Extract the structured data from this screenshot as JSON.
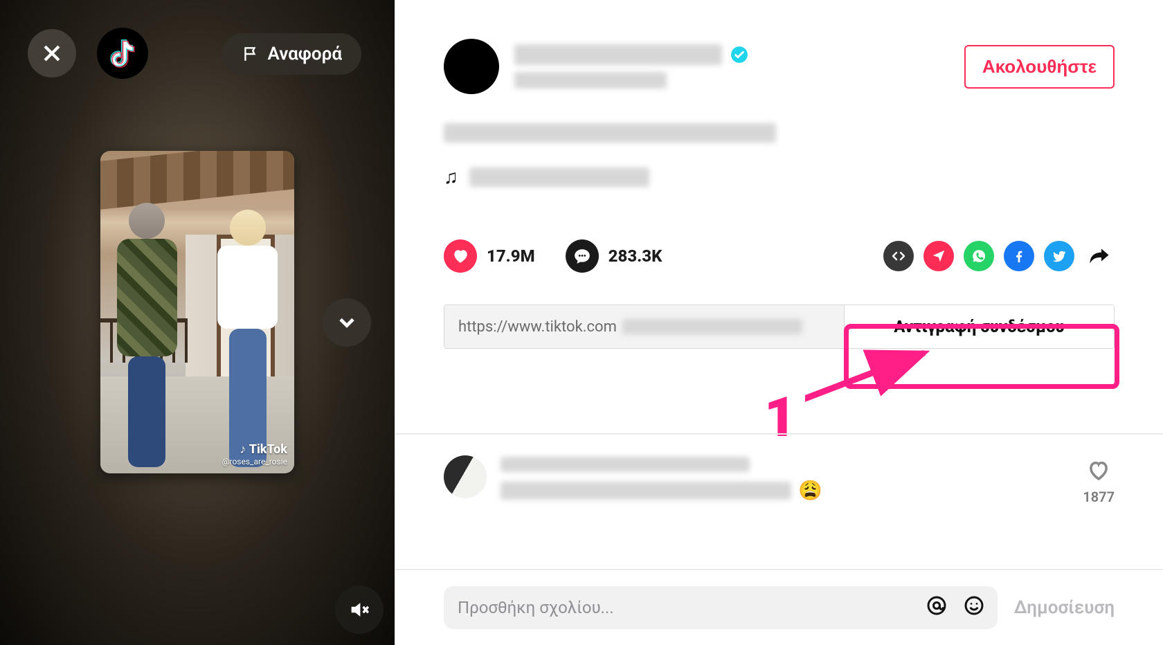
{
  "video_pane": {
    "report_label": "Αναφορά",
    "watermark_main": "TikTok",
    "watermark_handle": "@roses_are_rosie"
  },
  "header": {
    "follow_label": "Ακολουθήστε"
  },
  "music": {
    "note_glyph": "♫"
  },
  "stats": {
    "likes": "17.9M",
    "comments": "283.3K"
  },
  "link": {
    "url_visible": "https://www.tiktok.com",
    "copy_label": "Αντιγραφή συνδέσμου"
  },
  "callout": {
    "number": "1"
  },
  "comments": {
    "first": {
      "emoji": "😩",
      "likes": "1877"
    }
  },
  "composer": {
    "placeholder": "Προσθήκη σχολίου...",
    "post_label": "Δημοσίευση"
  }
}
